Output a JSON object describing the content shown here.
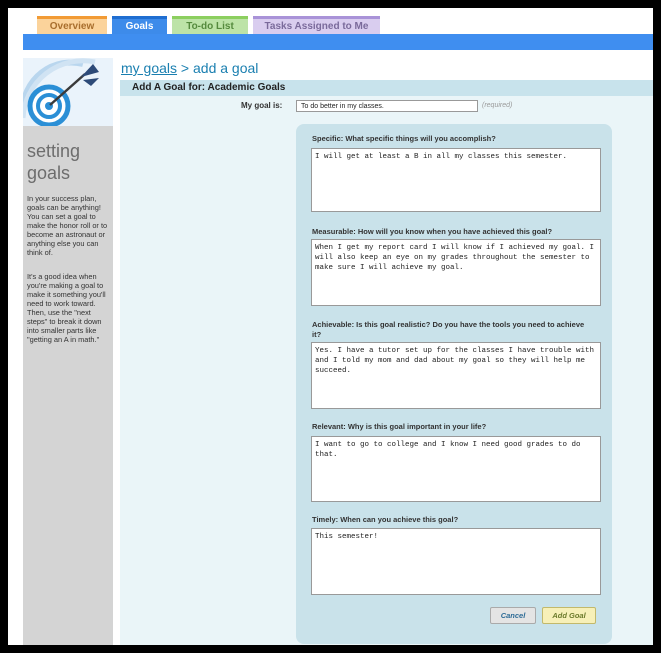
{
  "tabs": [
    {
      "label": "Overview"
    },
    {
      "label": "Goals"
    },
    {
      "label": "To-do List"
    },
    {
      "label": "Tasks Assigned to Me"
    }
  ],
  "breadcrumb": {
    "link": "my goals",
    "separator": ">",
    "current": "add a goal"
  },
  "sidebar": {
    "title_line1": "setting",
    "title_line2": "goals",
    "paragraph1": "In your success plan, goals can be anything! You can set a goal to make the honor roll or to become an astronaut or anything else you can think of.",
    "paragraph2": "It's a good idea when you're making a goal to make it something you'll need to work toward. Then, use the \"next steps\" to break it down into smaller parts like \"getting an A in math.\""
  },
  "form": {
    "heading": "Add A Goal for: Academic Goals",
    "goal_label": "My goal is:",
    "goal_value": "To do better in my classes.",
    "required_hint": "(required)",
    "questions": [
      {
        "label": "Specific: What specific things will you accomplish?",
        "answer": "I will get at least a B in all my classes this semester."
      },
      {
        "label": "Measurable: How will you know when you have achieved this goal?",
        "answer": "When I get my report card I will know if I achieved my goal. I will also keep an eye on my grades throughout the semester to make sure I will achieve my goal."
      },
      {
        "label": "Achievable: Is this goal realistic? Do you have the tools you need to achieve it?",
        "answer": "Yes. I have a tutor set up for the classes I have trouble with and I told my mom and dad about my goal so they will help me succeed."
      },
      {
        "label": "Relevant: Why is this goal important in your life?",
        "answer": "I want to go to college and I know I need good grades to do that."
      },
      {
        "label": "Timely: When can you achieve this goal?",
        "answer": "This semester!"
      }
    ],
    "cancel_label": "Cancel",
    "submit_label": "Add Goal"
  },
  "colors": {
    "accent": "#3f8ef0",
    "link": "#1a7fb0",
    "panel": "#eaf5f8",
    "card": "#c9e2ea"
  },
  "icons": {
    "logo": "target-dart-icon"
  }
}
